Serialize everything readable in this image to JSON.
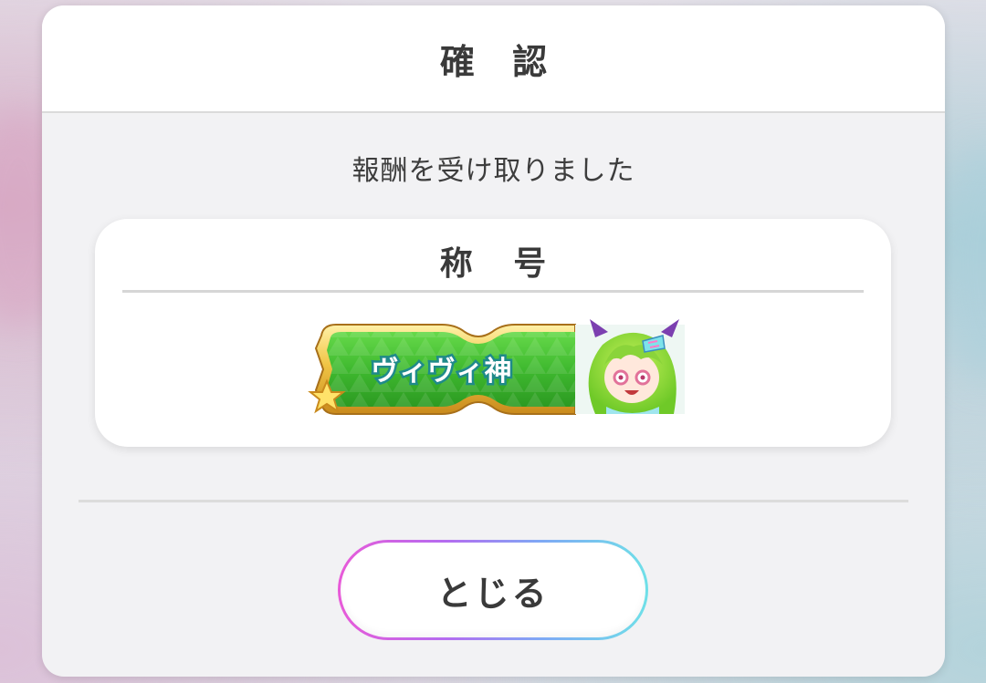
{
  "dialog": {
    "title": "確 認",
    "message": "報酬を受け取りました"
  },
  "reward": {
    "category": "称 号",
    "title_plate_text": "ヴィヴィ神",
    "plate_star_icon": "star-icon",
    "character_icon": "character-portrait-icon"
  },
  "close_button": {
    "label": "とじる"
  },
  "colors": {
    "plate_green": "#3fb92f",
    "plate_gold": "#e8b93a",
    "plate_text": "#ffffff",
    "plate_text_outline": "#1f8a8a",
    "button_gradient_start": "#e85ad8",
    "button_gradient_end": "#6fe0e8"
  }
}
